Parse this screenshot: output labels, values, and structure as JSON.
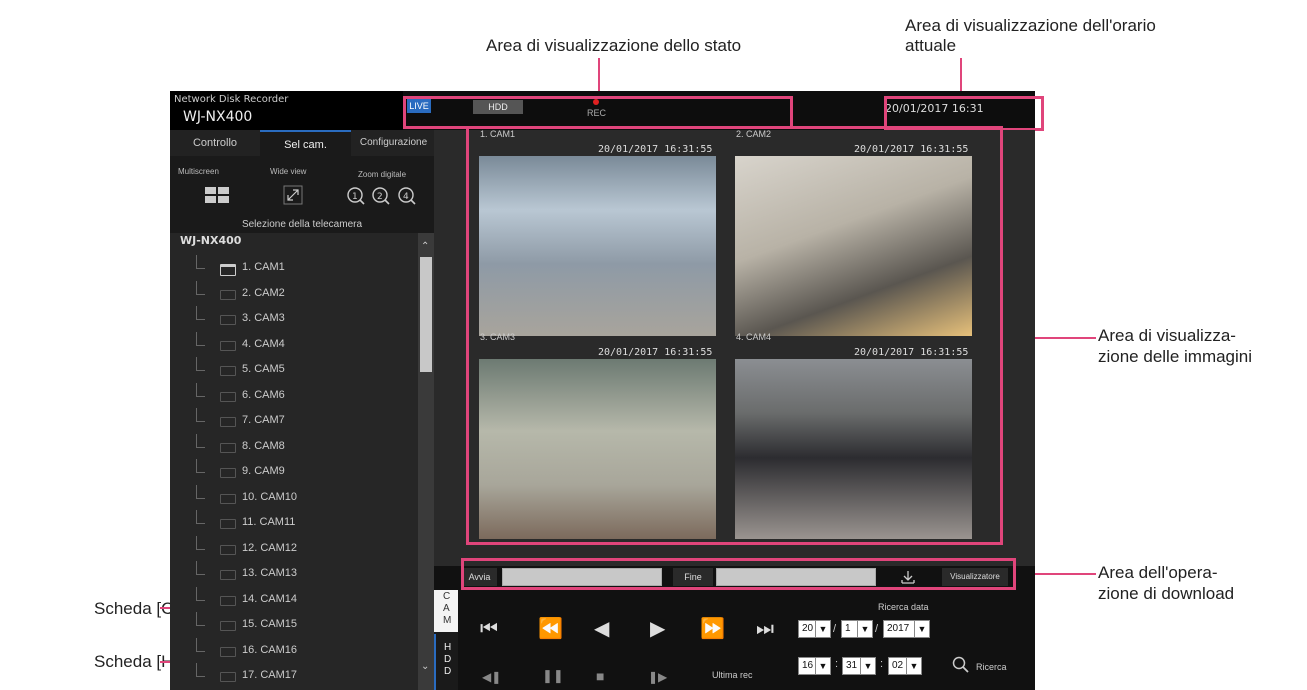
{
  "callouts": {
    "status_area": "Area di visualizzazione dello stato",
    "time_area_line1": "Area di visualizzazione dell'orario",
    "time_area_line2": "attuale",
    "image_area_line1": "Area di visualizza-",
    "image_area_line2": "zione delle immagini",
    "download_area_line1": "Area dell'opera-",
    "download_area_line2": "zione di download",
    "cam_tab": "Scheda [CAM]",
    "hdd_tab": "Scheda [HDD]"
  },
  "header": {
    "product_line": "Network Disk Recorder",
    "model": "WJ-NX400",
    "live_badge": "LIVE",
    "hdd_badge": "HDD",
    "rec_label": "REC",
    "current_time": "20/01/2017  16:31"
  },
  "tabs": [
    "Controllo",
    "Sel cam.",
    "Configurazione"
  ],
  "toolbar": {
    "multiscreen": "Multiscreen",
    "wide_view": "Wide view",
    "zoom_digitale": "Zoom digitale",
    "zoom_levels": [
      "1",
      "2",
      "4"
    ]
  },
  "camera_select": {
    "title": "Selezione della telecamera",
    "root": "WJ-NX400",
    "cameras": [
      "1. CAM1",
      "2. CAM2",
      "3. CAM3",
      "4. CAM4",
      "5. CAM5",
      "6. CAM6",
      "7. CAM7",
      "8. CAM8",
      "9. CAM9",
      "10. CAM10",
      "11. CAM11",
      "12. CAM12",
      "13. CAM13",
      "14. CAM14",
      "15. CAM15",
      "16. CAM16",
      "17. CAM17"
    ]
  },
  "side_tabs": {
    "cam": "CAM",
    "hdd": "HDD"
  },
  "tiles": [
    {
      "name": "1. CAM1",
      "timestamp": "20/01/2017  16:31:55"
    },
    {
      "name": "2. CAM2",
      "timestamp": "20/01/2017  16:31:55"
    },
    {
      "name": "3. CAM3",
      "timestamp": "20/01/2017  16:31:55"
    },
    {
      "name": "4. CAM4",
      "timestamp": "20/01/2017  16:31:55"
    }
  ],
  "download": {
    "start_label": "Avvia",
    "end_label": "Fine",
    "viewer_label": "Visualizzatore"
  },
  "playback": {
    "search_date_label": "Ricerca data",
    "date": {
      "day": "20",
      "month": "1",
      "year": "2017"
    },
    "time": {
      "hour": "16",
      "minute": "31",
      "second": "02"
    },
    "search_label": "Ricerca",
    "last_rec_label": "Ultima rec"
  },
  "colors": {
    "accent": "#e0457b",
    "live_badge": "#2a6cc0",
    "rec_dot": "#e02020"
  }
}
